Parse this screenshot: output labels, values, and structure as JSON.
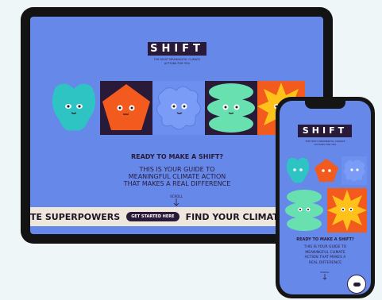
{
  "brand": {
    "logo": "SHIFT",
    "tagline_line1": "THE MOST MEANINGFUL CLIMATE",
    "tagline_line2": "ACTIONS FOR YOU"
  },
  "tablet": {
    "heading": "READY TO MAKE A SHIFT?",
    "subheading_lines": [
      "THIS IS YOUR GUIDE TO",
      "MEANINGFUL CLIMATE ACTION",
      "THAT MAKES A REAL DIFFERENCE"
    ],
    "scroll_label": "SCROLL",
    "marquee": {
      "text_left": "TE SUPERPOWERS",
      "cta_label": "GET STARTED HERE",
      "text_right": "FIND YOUR CLIMATE SUPERPOW"
    }
  },
  "phone": {
    "heading": "READY TO MAKE A SHIFT?",
    "subheading_lines": [
      "THIS IS YOUR GUIDE TO",
      "MEANINGFUL CLIMATE",
      "ACTION THAT MAKES A",
      "REAL DIFFERENCE"
    ],
    "scroll_label": "SCROLL"
  },
  "colors": {
    "background": "#6688e8",
    "dark": "#2a1a3a",
    "teal": "#2ec4c4",
    "orange": "#f25a1e",
    "mint": "#69e0b0",
    "yellow": "#ffc21a",
    "marquee_bg": "#eee8dc"
  },
  "icons": [
    "scroll-arrow-icon",
    "start-badge-icon"
  ]
}
